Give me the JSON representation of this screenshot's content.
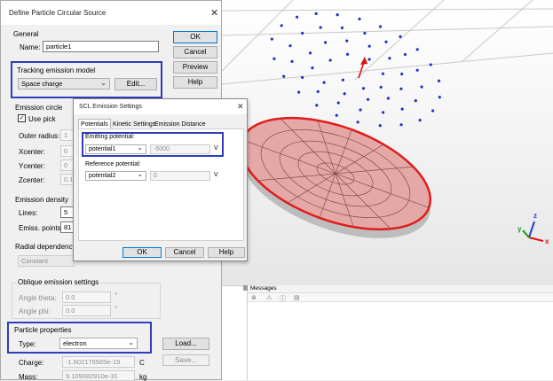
{
  "main_dialog": {
    "title": "Define Particle Circular Source",
    "buttons": {
      "ok": "OK",
      "cancel": "Cancel",
      "preview": "Preview",
      "help": "Help"
    },
    "general": {
      "title": "General",
      "name_label": "Name:",
      "name_value": "particle1"
    },
    "tracking": {
      "title": "Tracking emission model",
      "model": "Space charge",
      "edit": "Edit..."
    },
    "circle": {
      "title": "Emission circle",
      "use_pick": "Use pick",
      "outer_radius_label": "Outer radius:",
      "outer_radius_value": "1",
      "xcenter_label": "Xcenter:",
      "xcenter_value": "0",
      "ycenter_label": "Ycenter:",
      "ycenter_value": "0",
      "zcenter_label": "Zcenter:",
      "zcenter_value": "0.1"
    },
    "density": {
      "title": "Emission density",
      "lines_label": "Lines:",
      "lines_value": "5",
      "points_label": "Emiss. points:",
      "points_value": "81"
    },
    "radial": {
      "title": "Radial dependency",
      "value": "Constant"
    },
    "oblique": {
      "title": "Oblique emission settings",
      "theta_label": "Angle theta:",
      "theta_value": "0.0",
      "theta_unit": "°",
      "phi_label": "Angle phi:",
      "phi_value": "0.0",
      "phi_unit": "°"
    },
    "particle": {
      "title": "Particle properties",
      "type_label": "Type:",
      "type_value": "electron",
      "load": "Load...",
      "save": "Save...",
      "charge_label": "Charge:",
      "charge_value": "-1.602176565e-19",
      "charge_unit": "C",
      "mass_label": "Mass:",
      "mass_value": "9.109382910e-31",
      "mass_unit": "kg"
    }
  },
  "scl_dialog": {
    "title": "SCL Emission Settings",
    "tabs": [
      "Potentials",
      "Kinetic Settings",
      "Emission Distance"
    ],
    "emitting": {
      "label": "Emitting potential:",
      "select": "potential1",
      "value": "-5000",
      "unit": "V"
    },
    "reference": {
      "label": "Reference potential:",
      "select": "potential2",
      "value": "0",
      "unit": "V"
    },
    "buttons": {
      "ok": "OK",
      "cancel": "Cancel",
      "help": "Help"
    }
  },
  "messages": {
    "title": "Messages"
  },
  "axes": {
    "x": "x",
    "y": "y",
    "z": "z"
  },
  "colors": {
    "highlight": "#2f3dbd",
    "points": "#1f2fc9",
    "disk_edge": "#e11c1c",
    "disk_face": "#e4a9a7"
  }
}
